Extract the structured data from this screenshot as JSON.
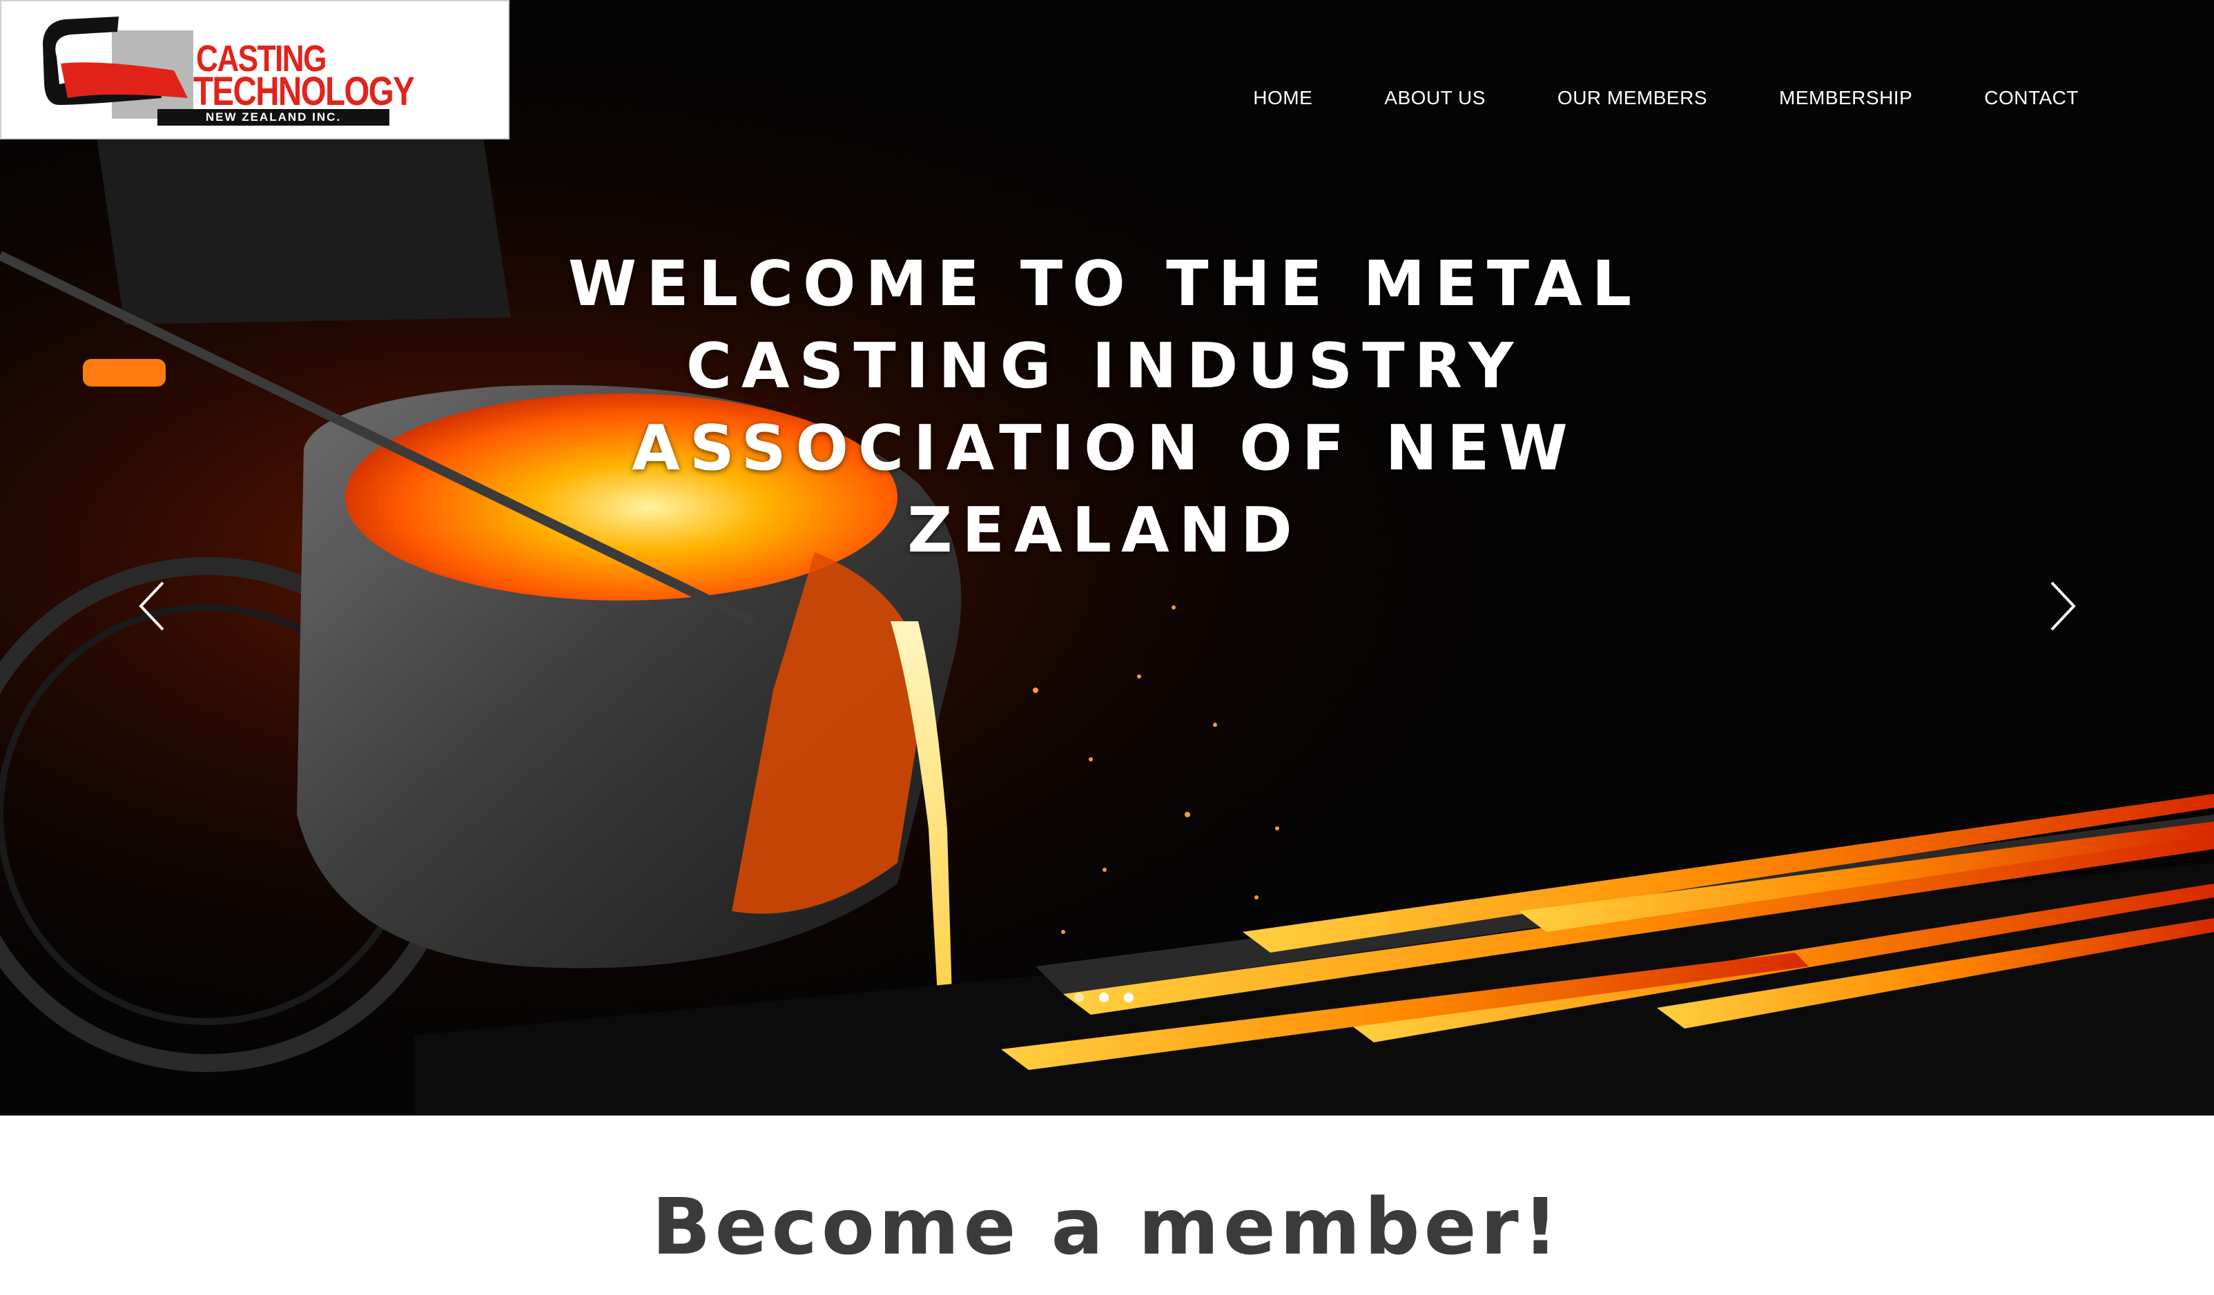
{
  "logo": {
    "line1": "CASTING",
    "line2": "TECHNOLOGY",
    "line3": "NEW ZEALAND INC."
  },
  "nav": {
    "items": [
      {
        "label": "HOME"
      },
      {
        "label": "ABOUT US"
      },
      {
        "label": "OUR MEMBERS"
      },
      {
        "label": "MEMBERSHIP"
      },
      {
        "label": "CONTACT"
      }
    ]
  },
  "hero": {
    "headline_lines": [
      "WELCOME TO THE METAL",
      "CASTING INDUSTRY",
      "ASSOCIATION OF NEW",
      "ZEALAND"
    ],
    "slide_count": 3,
    "active_slide": 1
  },
  "section": {
    "title": "Become a member!"
  },
  "colors": {
    "brand_red": "#e2231a",
    "molten": "#ff6a00",
    "heading_grey": "#3b3b3b"
  }
}
